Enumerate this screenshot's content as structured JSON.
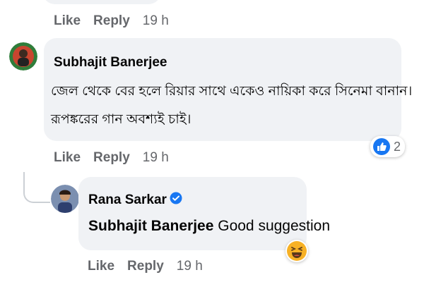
{
  "top_actions": {
    "like": "Like",
    "reply": "Reply",
    "time": "19 h"
  },
  "comment1": {
    "author": "Subhajit Banerjee",
    "line1": "জেল থেকে বের হলে রিয়ার সাথে একেও নায়িকা করে সিনেমা বানান।",
    "line2": "রূপঙ্করের গান অবশ্যই চাই।",
    "reaction_count": "2",
    "actions": {
      "like": "Like",
      "reply": "Reply",
      "time": "19 h"
    }
  },
  "reply1": {
    "author": "Rana Sarkar",
    "mention": "Subhajit Banerjee",
    "text": "Good suggestion",
    "actions": {
      "like": "Like",
      "reply": "Reply",
      "time": "19 h"
    }
  },
  "colors": {
    "bubble": "#f0f2f5",
    "meta": "#65676b",
    "like_blue": "#1877f2",
    "haha_yellow": "#f7b125"
  },
  "icons": [
    "like-reaction-icon",
    "haha-reaction-icon",
    "verified-badge-icon"
  ]
}
